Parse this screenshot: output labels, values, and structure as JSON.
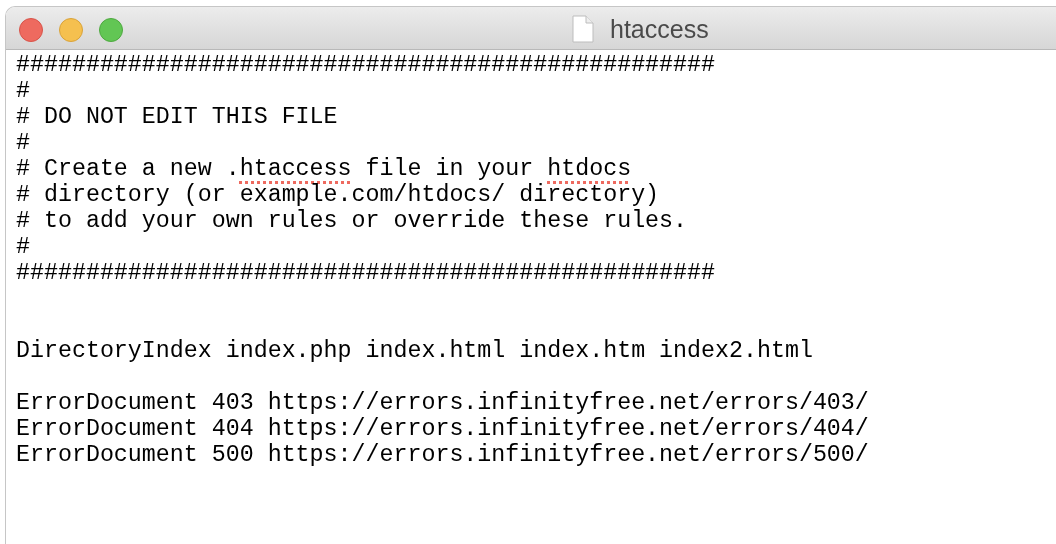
{
  "window": {
    "title": "htaccess"
  },
  "document": {
    "lines": [
      {
        "kind": "text",
        "segments": [
          {
            "text": "##################################################",
            "misspelled": false
          }
        ]
      },
      {
        "kind": "text",
        "segments": [
          {
            "text": "#",
            "misspelled": false
          }
        ]
      },
      {
        "kind": "text",
        "segments": [
          {
            "text": "# DO NOT EDIT THIS FILE",
            "misspelled": false
          }
        ]
      },
      {
        "kind": "text",
        "segments": [
          {
            "text": "#",
            "misspelled": false
          }
        ]
      },
      {
        "kind": "text",
        "segments": [
          {
            "text": "# Create a new .",
            "misspelled": false
          },
          {
            "text": "htaccess",
            "misspelled": true
          },
          {
            "text": " file in your ",
            "misspelled": false
          },
          {
            "text": "htdocs",
            "misspelled": true
          }
        ]
      },
      {
        "kind": "text",
        "segments": [
          {
            "text": "# directory (or example.com/htdocs/ directory)",
            "misspelled": false
          }
        ]
      },
      {
        "kind": "text",
        "segments": [
          {
            "text": "# to add your own rules or override these rules.",
            "misspelled": false
          }
        ]
      },
      {
        "kind": "text",
        "segments": [
          {
            "text": "#",
            "misspelled": false
          }
        ]
      },
      {
        "kind": "text",
        "segments": [
          {
            "text": "##################################################",
            "misspelled": false
          }
        ]
      },
      {
        "kind": "blank"
      },
      {
        "kind": "blank"
      },
      {
        "kind": "text",
        "segments": [
          {
            "text": "DirectoryIndex index.php index.html index.htm index2.html",
            "misspelled": false
          }
        ]
      },
      {
        "kind": "blank"
      },
      {
        "kind": "text",
        "segments": [
          {
            "text": "ErrorDocument 403 https://errors.infinityfree.net/errors/403/",
            "misspelled": false
          }
        ]
      },
      {
        "kind": "text",
        "segments": [
          {
            "text": "ErrorDocument 404 https://errors.infinityfree.net/errors/404/",
            "misspelled": false
          }
        ]
      },
      {
        "kind": "text",
        "segments": [
          {
            "text": "ErrorDocument 500 https://errors.infinityfree.net/errors/500/",
            "misspelled": false
          }
        ]
      }
    ]
  }
}
